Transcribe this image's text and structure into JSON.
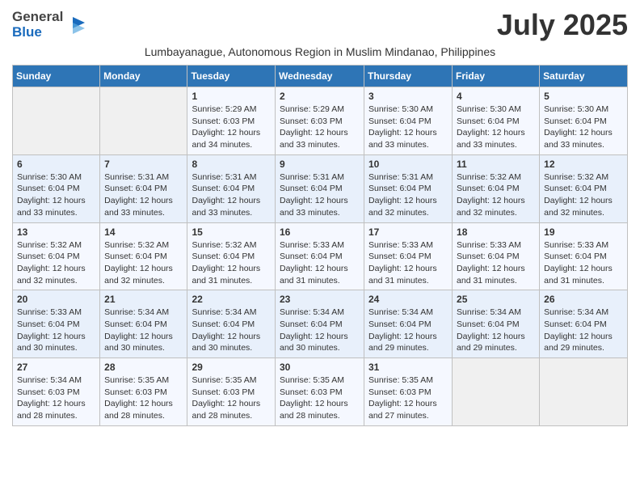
{
  "header": {
    "logo_general": "General",
    "logo_blue": "Blue",
    "month_year": "July 2025",
    "subtitle": "Lumbayanague, Autonomous Region in Muslim Mindanao, Philippines"
  },
  "days_of_week": [
    "Sunday",
    "Monday",
    "Tuesday",
    "Wednesday",
    "Thursday",
    "Friday",
    "Saturday"
  ],
  "weeks": [
    [
      {
        "day": "",
        "info": ""
      },
      {
        "day": "",
        "info": ""
      },
      {
        "day": "1",
        "sunrise": "5:29 AM",
        "sunset": "6:03 PM",
        "daylight": "12 hours and 34 minutes."
      },
      {
        "day": "2",
        "sunrise": "5:29 AM",
        "sunset": "6:03 PM",
        "daylight": "12 hours and 33 minutes."
      },
      {
        "day": "3",
        "sunrise": "5:30 AM",
        "sunset": "6:04 PM",
        "daylight": "12 hours and 33 minutes."
      },
      {
        "day": "4",
        "sunrise": "5:30 AM",
        "sunset": "6:04 PM",
        "daylight": "12 hours and 33 minutes."
      },
      {
        "day": "5",
        "sunrise": "5:30 AM",
        "sunset": "6:04 PM",
        "daylight": "12 hours and 33 minutes."
      }
    ],
    [
      {
        "day": "6",
        "sunrise": "5:30 AM",
        "sunset": "6:04 PM",
        "daylight": "12 hours and 33 minutes."
      },
      {
        "day": "7",
        "sunrise": "5:31 AM",
        "sunset": "6:04 PM",
        "daylight": "12 hours and 33 minutes."
      },
      {
        "day": "8",
        "sunrise": "5:31 AM",
        "sunset": "6:04 PM",
        "daylight": "12 hours and 33 minutes."
      },
      {
        "day": "9",
        "sunrise": "5:31 AM",
        "sunset": "6:04 PM",
        "daylight": "12 hours and 33 minutes."
      },
      {
        "day": "10",
        "sunrise": "5:31 AM",
        "sunset": "6:04 PM",
        "daylight": "12 hours and 32 minutes."
      },
      {
        "day": "11",
        "sunrise": "5:32 AM",
        "sunset": "6:04 PM",
        "daylight": "12 hours and 32 minutes."
      },
      {
        "day": "12",
        "sunrise": "5:32 AM",
        "sunset": "6:04 PM",
        "daylight": "12 hours and 32 minutes."
      }
    ],
    [
      {
        "day": "13",
        "sunrise": "5:32 AM",
        "sunset": "6:04 PM",
        "daylight": "12 hours and 32 minutes."
      },
      {
        "day": "14",
        "sunrise": "5:32 AM",
        "sunset": "6:04 PM",
        "daylight": "12 hours and 32 minutes."
      },
      {
        "day": "15",
        "sunrise": "5:32 AM",
        "sunset": "6:04 PM",
        "daylight": "12 hours and 31 minutes."
      },
      {
        "day": "16",
        "sunrise": "5:33 AM",
        "sunset": "6:04 PM",
        "daylight": "12 hours and 31 minutes."
      },
      {
        "day": "17",
        "sunrise": "5:33 AM",
        "sunset": "6:04 PM",
        "daylight": "12 hours and 31 minutes."
      },
      {
        "day": "18",
        "sunrise": "5:33 AM",
        "sunset": "6:04 PM",
        "daylight": "12 hours and 31 minutes."
      },
      {
        "day": "19",
        "sunrise": "5:33 AM",
        "sunset": "6:04 PM",
        "daylight": "12 hours and 31 minutes."
      }
    ],
    [
      {
        "day": "20",
        "sunrise": "5:33 AM",
        "sunset": "6:04 PM",
        "daylight": "12 hours and 30 minutes."
      },
      {
        "day": "21",
        "sunrise": "5:34 AM",
        "sunset": "6:04 PM",
        "daylight": "12 hours and 30 minutes."
      },
      {
        "day": "22",
        "sunrise": "5:34 AM",
        "sunset": "6:04 PM",
        "daylight": "12 hours and 30 minutes."
      },
      {
        "day": "23",
        "sunrise": "5:34 AM",
        "sunset": "6:04 PM",
        "daylight": "12 hours and 30 minutes."
      },
      {
        "day": "24",
        "sunrise": "5:34 AM",
        "sunset": "6:04 PM",
        "daylight": "12 hours and 29 minutes."
      },
      {
        "day": "25",
        "sunrise": "5:34 AM",
        "sunset": "6:04 PM",
        "daylight": "12 hours and 29 minutes."
      },
      {
        "day": "26",
        "sunrise": "5:34 AM",
        "sunset": "6:04 PM",
        "daylight": "12 hours and 29 minutes."
      }
    ],
    [
      {
        "day": "27",
        "sunrise": "5:34 AM",
        "sunset": "6:03 PM",
        "daylight": "12 hours and 28 minutes."
      },
      {
        "day": "28",
        "sunrise": "5:35 AM",
        "sunset": "6:03 PM",
        "daylight": "12 hours and 28 minutes."
      },
      {
        "day": "29",
        "sunrise": "5:35 AM",
        "sunset": "6:03 PM",
        "daylight": "12 hours and 28 minutes."
      },
      {
        "day": "30",
        "sunrise": "5:35 AM",
        "sunset": "6:03 PM",
        "daylight": "12 hours and 28 minutes."
      },
      {
        "day": "31",
        "sunrise": "5:35 AM",
        "sunset": "6:03 PM",
        "daylight": "12 hours and 27 minutes."
      },
      {
        "day": "",
        "info": ""
      },
      {
        "day": "",
        "info": ""
      }
    ]
  ]
}
